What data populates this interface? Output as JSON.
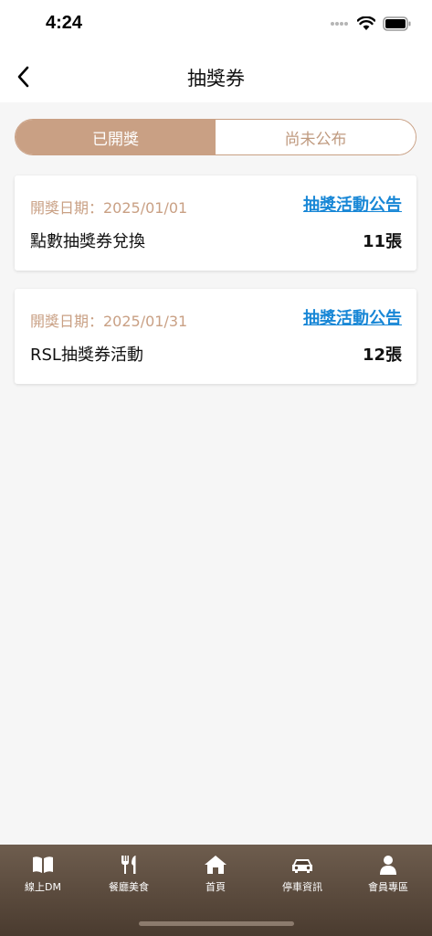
{
  "status": {
    "time": "4:24"
  },
  "nav": {
    "title": "抽獎券"
  },
  "segments": {
    "active": "已開獎",
    "inactive": "尚未公布"
  },
  "cards": [
    {
      "date": "開獎日期：2025/01/01",
      "link": "抽獎活動公告",
      "name": "點數抽獎券兌換",
      "count": "11張"
    },
    {
      "date": "開獎日期：2025/01/31",
      "link": "抽獎活動公告",
      "name": "RSL抽獎券活動",
      "count": "12張"
    }
  ],
  "tabbar": {
    "items": [
      {
        "label": "線上DM",
        "icon": "book-icon"
      },
      {
        "label": "餐廳美食",
        "icon": "fork-knife-icon"
      },
      {
        "label": "首頁",
        "icon": "home-icon"
      },
      {
        "label": "停車資訊",
        "icon": "car-icon"
      },
      {
        "label": "會員專區",
        "icon": "person-icon"
      }
    ]
  },
  "colors": {
    "accent": "#c9a084",
    "link": "#1887d6",
    "tabbar": "#5a4a3d"
  }
}
